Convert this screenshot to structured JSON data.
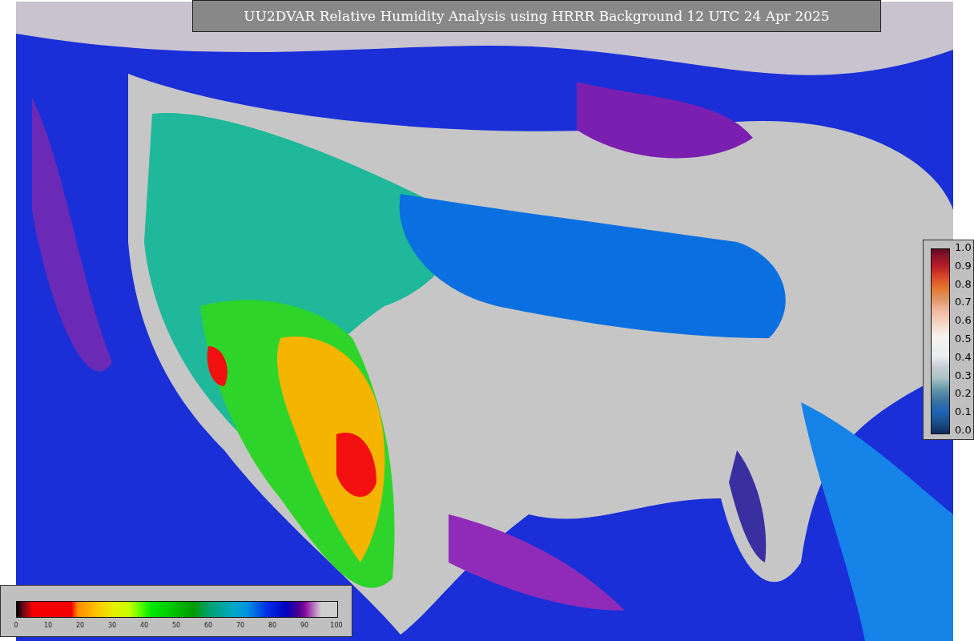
{
  "title": "UU2DVAR Relative Humidity Analysis using HRRR Background 12 UTC 24 Apr 2025",
  "ratio_legend": {
    "ticks": [
      "1.0",
      "0.9",
      "0.8",
      "0.7",
      "0.6",
      "0.5",
      "0.4",
      "0.3",
      "0.2",
      "0.1",
      "0.0"
    ]
  },
  "percent_legend": {
    "ticks": [
      "0",
      "10",
      "20",
      "30",
      "40",
      "50",
      "60",
      "70",
      "80",
      "90",
      "100"
    ]
  }
}
